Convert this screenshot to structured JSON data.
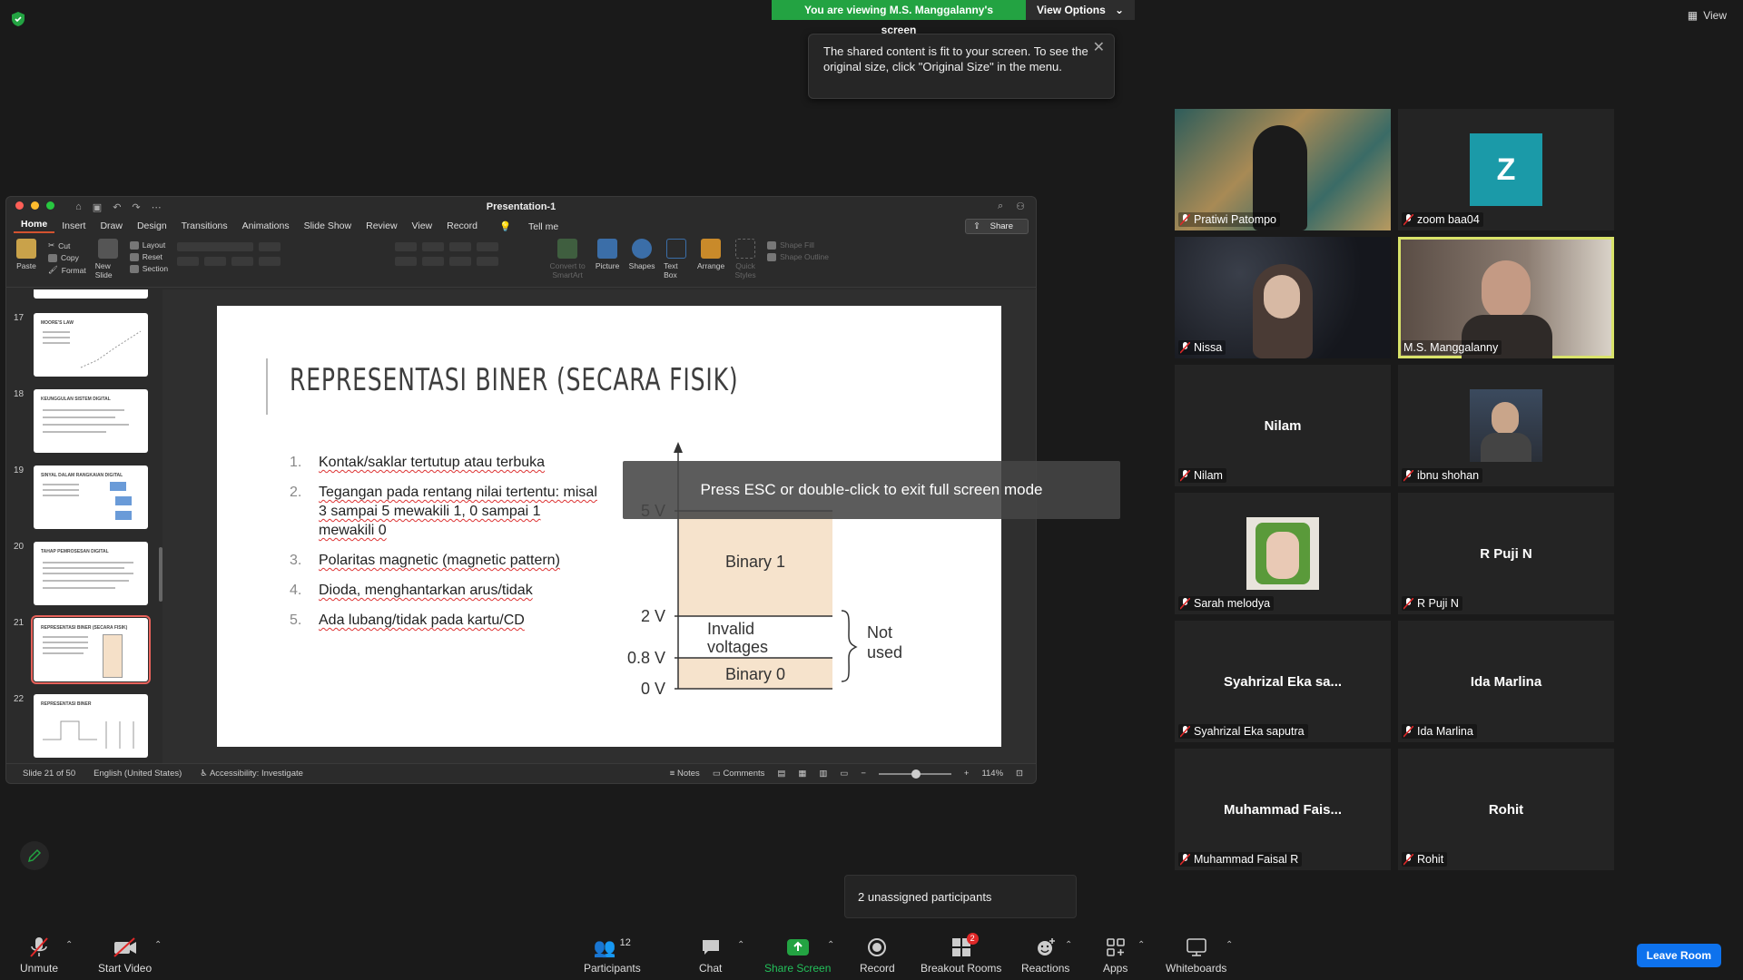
{
  "banner": {
    "viewing_text": "You are viewing M.S. Manggalanny's screen",
    "view_options_label": "View Options",
    "view_label": "View"
  },
  "tooltip": {
    "text": "The shared content is fit to your screen. To see the original size, click \"Original Size\" in the menu."
  },
  "ppt": {
    "title": "Presentation-1",
    "tabs": [
      "Home",
      "Insert",
      "Draw",
      "Design",
      "Transitions",
      "Animations",
      "Slide Show",
      "Review",
      "View",
      "Record",
      "Tell me"
    ],
    "share_label": "Share",
    "ribbon": {
      "paste": "Paste",
      "cut": "Cut",
      "copy": "Copy",
      "format": "Format",
      "new_slide": "New Slide",
      "layout": "Layout",
      "reset": "Reset",
      "section": "Section",
      "convert": "Convert to SmartArt",
      "picture": "Picture",
      "shapes": "Shapes",
      "text_box": "Text Box",
      "arrange": "Arrange",
      "quick_styles": "Quick Styles",
      "shape_fill": "Shape Fill",
      "shape_outline": "Shape Outline"
    },
    "thumbnails": [
      {
        "num": "17",
        "title": "MOORE'S LAW"
      },
      {
        "num": "18",
        "title": "KEUNGGULAN SISTEM DIGITAL"
      },
      {
        "num": "19",
        "title": "SINYAL DALAM RANGKAIAN DIGITAL"
      },
      {
        "num": "20",
        "title": "TAHAP PEMROSESAN DIGITAL"
      },
      {
        "num": "21",
        "title": "REPRESENTASI BINER (SECARA FISIK)"
      },
      {
        "num": "22",
        "title": "REPRESENTASI BINER"
      }
    ],
    "slide": {
      "title": "REPRESENTASI BINER (SECARA FISIK)",
      "items": [
        {
          "n": "1.",
          "text": "Kontak/saklar tertutup atau terbuka"
        },
        {
          "n": "2.",
          "text": "Tegangan pada rentang nilai tertentu: misal 3 sampai 5 mewakili 1, 0 sampai 1 mewakili 0"
        },
        {
          "n": "3.",
          "text": "Polaritas magnetic (magnetic pattern)"
        },
        {
          "n": "4.",
          "text": "Dioda, menghantarkan arus/tidak"
        },
        {
          "n": "5.",
          "text": "Ada lubang/tidak pada kartu/CD"
        }
      ],
      "diagram": {
        "v5": "5 V",
        "v2": "2 V",
        "v08": "0.8 V",
        "v0": "0 V",
        "binary1": "Binary 1",
        "invalid_1": "Invalid",
        "invalid_2": "voltages",
        "binary0": "Binary 0",
        "not_used_1": "Not",
        "not_used_2": "used"
      }
    },
    "fullscreen_msg": "Press ESC or double-click to exit full screen mode",
    "status": {
      "slide_of": "Slide 21 of 50",
      "language": "English (United States)",
      "accessibility": "Accessibility: Investigate",
      "notes": "Notes",
      "comments": "Comments",
      "zoom": "114%"
    }
  },
  "participants": [
    {
      "name": "Pratiwi Patompo",
      "center": ""
    },
    {
      "name": "zoom baa04",
      "center": "Z"
    },
    {
      "name": "Nissa",
      "center": ""
    },
    {
      "name": "M.S. Manggalanny",
      "center": ""
    },
    {
      "name": "Nilam",
      "center": "Nilam"
    },
    {
      "name": "ibnu shohan",
      "center": ""
    },
    {
      "name": "Sarah melodya",
      "center": ""
    },
    {
      "name": "R Puji N",
      "center": "R Puji N"
    },
    {
      "name": "Syahrizal Eka saputra",
      "center": "Syahrizal Eka sa..."
    },
    {
      "name": "Ida Marlina",
      "center": "Ida Marlina"
    },
    {
      "name": "Muhammad Faisal R",
      "center": "Muhammad Fais..."
    },
    {
      "name": "Rohit",
      "center": "Rohit"
    }
  ],
  "unassigned": "2 unassigned participants",
  "toolbar": {
    "unmute": "Unmute",
    "start_video": "Start Video",
    "participants": "Participants",
    "participants_count": "12",
    "chat": "Chat",
    "share_screen": "Share Screen",
    "record": "Record",
    "breakout_rooms": "Breakout Rooms",
    "breakout_badge": "2",
    "reactions": "Reactions",
    "apps": "Apps",
    "whiteboards": "Whiteboards",
    "leave_room": "Leave Room"
  },
  "colors": {
    "banner_green": "#23a342",
    "leave_blue": "#0e72ed",
    "active_speaker": "#d9e36a",
    "zoom_avatar": "#1b9aa8"
  }
}
